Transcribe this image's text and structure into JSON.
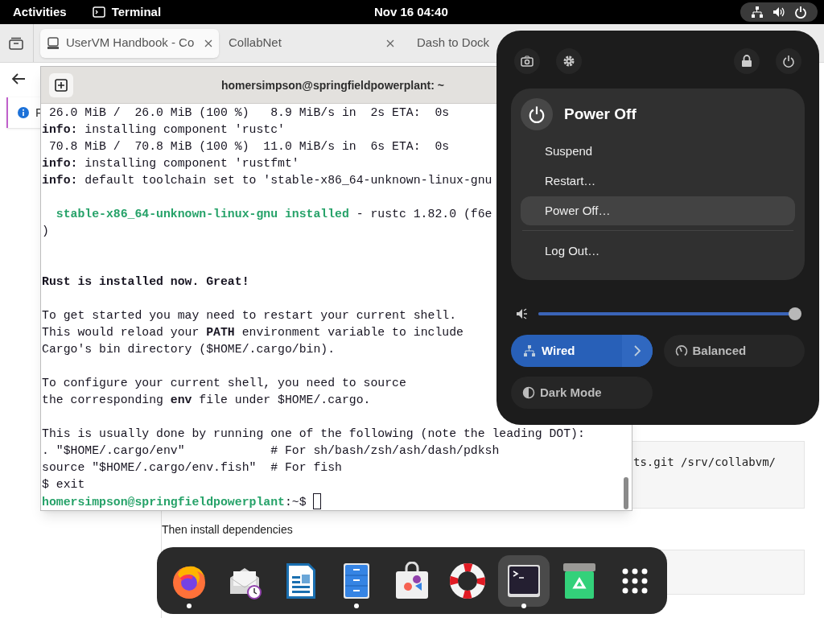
{
  "top_bar": {
    "activities": "Activities",
    "app_name": "Terminal",
    "clock": "Nov 16  04:40"
  },
  "browser": {
    "tabs": [
      {
        "title": "UserVM Handbook - Co",
        "selected": true
      },
      {
        "title": "CollabNet",
        "selected": false
      },
      {
        "title": "Dash to Dock",
        "selected": false
      }
    ],
    "banner_text": "F",
    "code_block_1": "ts.git /srv/collabvm/",
    "paragraph": "Then install dependencies"
  },
  "terminal": {
    "title": "homersimpson@springfieldpowerplant: ~",
    "lines": [
      {
        "kind": "text",
        "segments": [
          {
            "text": " 26.0 MiB /  26.0 MiB (100 %)   8.9 MiB/s in  2s ETA:  0s",
            "kind": "plain"
          }
        ]
      },
      {
        "kind": "text",
        "segments": [
          {
            "text": "info:",
            "kind": "bold"
          },
          {
            "text": " installing component 'rustc'",
            "kind": "plain"
          }
        ]
      },
      {
        "kind": "text",
        "segments": [
          {
            "text": " 70.8 MiB /  70.8 MiB (100 %)  11.0 MiB/s in  6s ETA:  0s",
            "kind": "plain"
          }
        ]
      },
      {
        "kind": "text",
        "segments": [
          {
            "text": "info:",
            "kind": "bold"
          },
          {
            "text": " installing component 'rustfmt'",
            "kind": "plain"
          }
        ]
      },
      {
        "kind": "text",
        "segments": [
          {
            "text": "info:",
            "kind": "bold"
          },
          {
            "text": " default toolchain set to 'stable-x86_64-unknown-linux-gnu",
            "kind": "plain"
          }
        ]
      },
      {
        "kind": "blank"
      },
      {
        "kind": "text",
        "segments": [
          {
            "text": "  stable-x86_64-unknown-linux-gnu installed",
            "kind": "green"
          },
          {
            "text": " - rustc 1.82.0 (f6e",
            "kind": "plain"
          }
        ]
      },
      {
        "kind": "text",
        "segments": [
          {
            "text": ")",
            "kind": "plain"
          }
        ]
      },
      {
        "kind": "blank"
      },
      {
        "kind": "blank"
      },
      {
        "kind": "text",
        "segments": [
          {
            "text": "Rust is installed now. Great!",
            "kind": "bold"
          }
        ]
      },
      {
        "kind": "blank"
      },
      {
        "kind": "text",
        "segments": [
          {
            "text": "To get started you may need to restart your current shell.",
            "kind": "plain"
          }
        ]
      },
      {
        "kind": "text",
        "segments": [
          {
            "text": "This would reload your ",
            "kind": "plain"
          },
          {
            "text": "PATH",
            "kind": "bold"
          },
          {
            "text": " environment variable to include",
            "kind": "plain"
          }
        ]
      },
      {
        "kind": "text",
        "segments": [
          {
            "text": "Cargo's bin directory ($HOME/.cargo/bin).",
            "kind": "plain"
          }
        ]
      },
      {
        "kind": "blank"
      },
      {
        "kind": "text",
        "segments": [
          {
            "text": "To configure your current shell, you need to source",
            "kind": "plain"
          }
        ]
      },
      {
        "kind": "text",
        "segments": [
          {
            "text": "the corresponding ",
            "kind": "plain"
          },
          {
            "text": "env",
            "kind": "bold"
          },
          {
            "text": " file under $HOME/.cargo.",
            "kind": "plain"
          }
        ]
      },
      {
        "kind": "blank"
      },
      {
        "kind": "text",
        "segments": [
          {
            "text": "This is usually done by running one of the following (note the leading DOT):",
            "kind": "plain"
          }
        ]
      },
      {
        "kind": "text",
        "segments": [
          {
            "text": ". \"$HOME/.cargo/env\"            # For sh/bash/zsh/ash/dash/pdksh",
            "kind": "plain"
          }
        ]
      },
      {
        "kind": "text",
        "segments": [
          {
            "text": "source \"$HOME/.cargo/env.fish\"  # For fish",
            "kind": "plain"
          }
        ]
      },
      {
        "kind": "text",
        "segments": [
          {
            "text": "$ exit",
            "kind": "plain"
          }
        ]
      },
      {
        "kind": "text",
        "segments": [
          {
            "text": "homersimpson@springfieldpowerplant",
            "kind": "green"
          },
          {
            "text": ":~$ ",
            "kind": "plain"
          }
        ]
      }
    ],
    "cursor": true
  },
  "quick_settings": {
    "power_menu": {
      "title": "Power Off",
      "items": [
        {
          "label": "Suspend",
          "selected": false,
          "separated": false
        },
        {
          "label": "Restart…",
          "selected": false,
          "separated": false
        },
        {
          "label": "Power Off…",
          "selected": true,
          "separated": false
        },
        {
          "label": "Log Out…",
          "selected": false,
          "separated": true
        }
      ]
    },
    "volume": {
      "level": 0.98
    },
    "toggles": [
      {
        "label": "Wired",
        "kind": "network",
        "on": true,
        "has_arrow": true
      },
      {
        "label": "Balanced",
        "kind": "power-mode",
        "on": false,
        "has_arrow": false
      },
      {
        "label": "Dark Mode",
        "kind": "dark-mode",
        "on": false,
        "has_arrow": false
      }
    ]
  },
  "dock": [
    {
      "kind": "firefox",
      "running": true,
      "selected": false
    },
    {
      "kind": "mail",
      "running": false,
      "selected": false
    },
    {
      "kind": "writer",
      "running": false,
      "selected": false
    },
    {
      "kind": "files",
      "running": true,
      "selected": false
    },
    {
      "kind": "software",
      "running": false,
      "selected": false
    },
    {
      "kind": "help",
      "running": false,
      "selected": false
    },
    {
      "kind": "terminal",
      "running": true,
      "selected": true
    },
    {
      "kind": "trash",
      "running": false,
      "selected": false
    },
    {
      "kind": "apps",
      "running": false,
      "selected": false
    }
  ]
}
